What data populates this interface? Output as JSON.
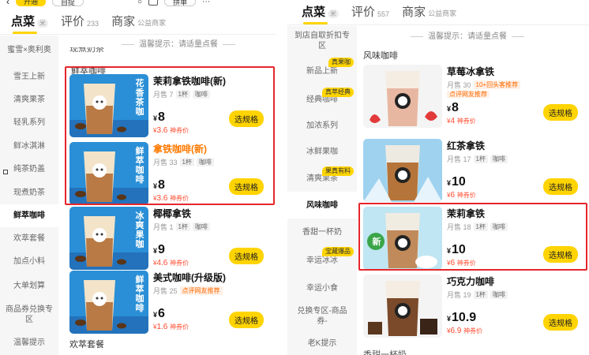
{
  "left": {
    "status": {
      "pill1": "开通",
      "pill2": "自提",
      "badge": "拼单"
    },
    "tabs": [
      {
        "label": "点菜",
        "sub": "米"
      },
      {
        "label": "评价",
        "sub": "233"
      },
      {
        "label": "商家",
        "sub": "公益商家"
      }
    ],
    "notice": "温馨提示：请适量点餐",
    "cut_heading": "现煮奶茶",
    "section_title": "鲜萃咖啡",
    "bottom_section": "欢萃套餐",
    "sidebar": [
      {
        "label": "蜜雪×奥利奥"
      },
      {
        "label": "雪王上新"
      },
      {
        "label": "清爽果茶"
      },
      {
        "label": "轻乳系列"
      },
      {
        "label": "鲜冰淇淋"
      },
      {
        "label": "纯茶奶盖"
      },
      {
        "label": "现煮奶茶"
      },
      {
        "label": "鲜萃咖啡",
        "active": true
      },
      {
        "label": "欢萃套餐"
      },
      {
        "label": "加点小料"
      },
      {
        "label": "大单划算"
      },
      {
        "label": "商品券兑换专区"
      },
      {
        "label": "温馨提示"
      }
    ],
    "products": [
      {
        "name": "茉莉拿铁咖啡(新)",
        "sold": "月售 7",
        "chips": [
          "1杯",
          "咖啡"
        ],
        "price": "8",
        "coupon": "3.6",
        "coupon_label": "神券价",
        "button": "选规格",
        "thumb_text": "花香茶咖",
        "thumb_color": "#2a8fd6"
      },
      {
        "name": "拿铁咖啡(新)",
        "name_color": "#ff7a00",
        "sold": "月售 33",
        "chips": [
          "1杯",
          "咖啡"
        ],
        "price": "8",
        "coupon": "3.6",
        "coupon_label": "神券价",
        "button": "选规格",
        "thumb_text": "鲜萃咖啡",
        "thumb_color": "#2a8fd6"
      },
      {
        "name": "椰椰拿铁",
        "sold": "月售 1",
        "chips": [
          "1杯",
          "咖啡"
        ],
        "price": "9",
        "coupon": "4.6",
        "coupon_label": "神券价",
        "button": "选规格",
        "thumb_text": "冰爽果咖",
        "thumb_color": "#2a8fd6"
      },
      {
        "name": "美式咖啡(升级版)",
        "sold": "月售 25",
        "hot": "点评网友推荐",
        "price": "6",
        "coupon": "1.6",
        "coupon_label": "神券价",
        "button": "选规格",
        "thumb_text": "鲜萃咖啡",
        "thumb_color": "#2a8fd6"
      }
    ]
  },
  "right": {
    "tabs": [
      {
        "label": "点菜",
        "sub": "米"
      },
      {
        "label": "评价",
        "sub": "557"
      },
      {
        "label": "商家",
        "sub": "公益商家"
      }
    ],
    "notice": "温馨提示：请适量点餐",
    "section_title": "风味咖啡",
    "bottom_cut": "香甜一杯奶",
    "sidebar": [
      {
        "label": "到店自取折扣专区"
      },
      {
        "label": "新品上新",
        "tag": "真果咖"
      },
      {
        "label": "经典咖啡",
        "tag": "真萃经典"
      },
      {
        "label": "加浓系列"
      },
      {
        "label": "冰鲜果咖"
      },
      {
        "label": "清爽果茶",
        "tag": "果真有料"
      },
      {
        "label": "风味咖啡",
        "active": true
      },
      {
        "label": "香甜一杯奶"
      },
      {
        "label": "幸运冰冰",
        "tag": "宝藏爆品"
      },
      {
        "label": "幸运小食"
      },
      {
        "label": "兑换专区-商品券-"
      },
      {
        "label": "老K提示"
      }
    ],
    "products": [
      {
        "name": "草莓冰拿铁",
        "sold": "月售 30",
        "hot": "10+回头客推荐",
        "hot2": "点评网友推荐",
        "price": "8",
        "coupon": "4",
        "coupon_label": "神券价",
        "button": "选规格",
        "bg": "#f4f4f4",
        "cup": "#e8b7a2",
        "accent": "#e23a3a"
      },
      {
        "name": "红茶拿铁",
        "sold": "月售 17",
        "chips": [
          "1杯",
          "咖啡"
        ],
        "price": "10",
        "coupon": "6",
        "coupon_label": "神券价",
        "button": "选规格",
        "bg": "#9ed2ee",
        "cup": "#b5743a",
        "accent": "#ffffff"
      },
      {
        "name": "茉莉拿铁",
        "sold": "月售 18",
        "chips": [
          "1杯",
          "咖啡"
        ],
        "price": "10",
        "coupon": "6",
        "coupon_label": "神券价",
        "button": "选规格",
        "bg": "#bfe6f2",
        "cup": "#c08a5a",
        "accent": "#3aa548",
        "badge": "新"
      },
      {
        "name": "巧克力咖啡",
        "sold": "月售 19",
        "chips": [
          "1杯",
          "咖啡"
        ],
        "price": "10.9",
        "coupon": "6.9",
        "coupon_label": "神券价",
        "button": "选规格",
        "bg": "#f4f4f4",
        "cup": "#7a4a2a",
        "accent": "#3a2418"
      }
    ]
  }
}
